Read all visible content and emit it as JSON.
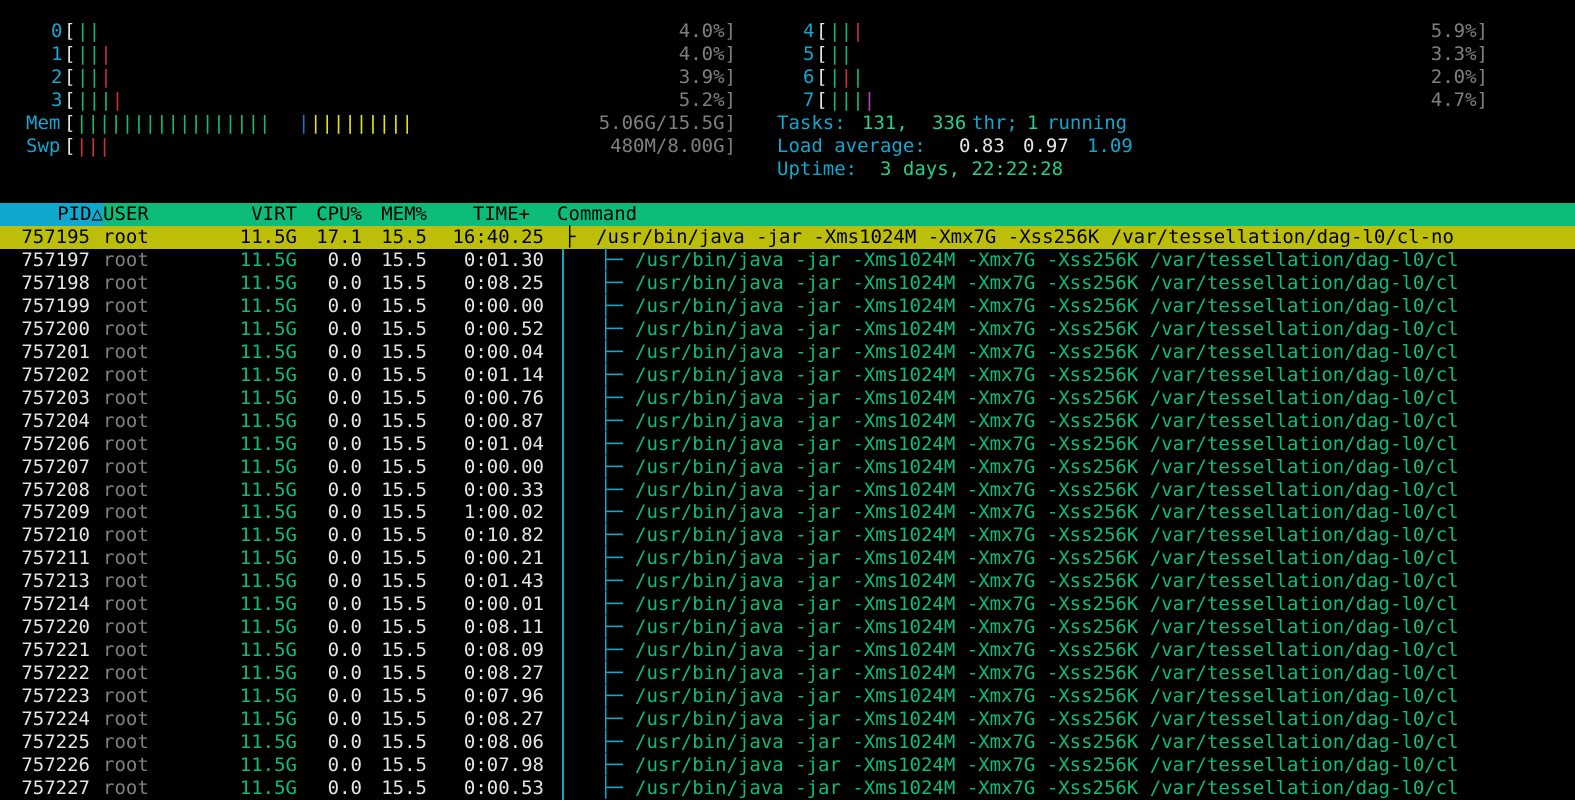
{
  "cpu_meters": [
    {
      "id": "0",
      "bars": "||",
      "colors": [
        "#0dbc79",
        "#0dbc79"
      ],
      "value": "4.0%]"
    },
    {
      "id": "1",
      "bars": "|||",
      "colors": [
        "#0dbc79",
        "#0dbc79",
        "#cd3131"
      ],
      "value": "4.0%]"
    },
    {
      "id": "2",
      "bars": "|||",
      "colors": [
        "#0dbc79",
        "#0dbc79",
        "#cd3131"
      ],
      "value": "3.9%]"
    },
    {
      "id": "3",
      "bars": "||||",
      "colors": [
        "#0dbc79",
        "#0dbc79",
        "#0dbc79",
        "#cd3131"
      ],
      "value": "5.2%]"
    },
    {
      "id": "4",
      "bars": "|||",
      "colors": [
        "#0dbc79",
        "#0dbc79",
        "#cd3131"
      ],
      "value": "5.9%]"
    },
    {
      "id": "5",
      "bars": "||",
      "colors": [
        "#0dbc79",
        "#0dbc79"
      ],
      "value": "3.3%]"
    },
    {
      "id": "6",
      "bars": "|||",
      "colors": [
        "#0dbc79",
        "#cd3131",
        "#0dbc79"
      ],
      "value": "2.0%]"
    },
    {
      "id": "7",
      "bars": "||||",
      "colors": [
        "#0dbc79",
        "#0dbc79",
        "#0dbc79",
        "#bc3fbc"
      ],
      "value": "4.7%]"
    }
  ],
  "mem": {
    "label": "Mem",
    "value": "5.06G/15.5G]",
    "green_bars": "|||||||||||||||||",
    "blue_bars": "|",
    "yellow_bars": "|||||||||"
  },
  "swp": {
    "label": "Swp",
    "value": "480M/8.00G]",
    "red_bars": "|||"
  },
  "tasks": {
    "label": "Tasks:",
    "count": "131,",
    "thr": "336",
    "thr_label": "thr;",
    "running": "1",
    "running_label": "running"
  },
  "load": {
    "label": "Load average:",
    "one": "0.83",
    "five": "0.97",
    "fifteen": "1.09"
  },
  "uptime": {
    "label": "Uptime:",
    "value": "3 days, 22:22:28"
  },
  "columns": {
    "pid": "PID△",
    "user": "USER",
    "virt": "VIRT",
    "cpu": "CPU%",
    "mem": "MEM%",
    "time": "TIME+",
    "command": "Command"
  },
  "selected_process": {
    "pid": "757195",
    "user": "root",
    "virt": "11.5G",
    "cpu": "17.1",
    "mem": "15.5",
    "time": "16:40.25",
    "tree": "├",
    "command": "/usr/bin/java -jar -Xms1024M -Xmx7G -Xss256K /var/tessellation/dag-l0/cl-no"
  },
  "threads": [
    {
      "pid": "757197",
      "user": "root",
      "virt": "11.5G",
      "cpu": "0.0",
      "mem": "15.5",
      "time": "0:01.30",
      "tree": "├─",
      "command": "/usr/bin/java -jar -Xms1024M -Xmx7G -Xss256K /var/tessellation/dag-l0/cl"
    },
    {
      "pid": "757198",
      "user": "root",
      "virt": "11.5G",
      "cpu": "0.0",
      "mem": "15.5",
      "time": "0:08.25",
      "tree": "├─",
      "command": "/usr/bin/java -jar -Xms1024M -Xmx7G -Xss256K /var/tessellation/dag-l0/cl"
    },
    {
      "pid": "757199",
      "user": "root",
      "virt": "11.5G",
      "cpu": "0.0",
      "mem": "15.5",
      "time": "0:00.00",
      "tree": "├─",
      "command": "/usr/bin/java -jar -Xms1024M -Xmx7G -Xss256K /var/tessellation/dag-l0/cl"
    },
    {
      "pid": "757200",
      "user": "root",
      "virt": "11.5G",
      "cpu": "0.0",
      "mem": "15.5",
      "time": "0:00.52",
      "tree": "├─",
      "command": "/usr/bin/java -jar -Xms1024M -Xmx7G -Xss256K /var/tessellation/dag-l0/cl"
    },
    {
      "pid": "757201",
      "user": "root",
      "virt": "11.5G",
      "cpu": "0.0",
      "mem": "15.5",
      "time": "0:00.04",
      "tree": "├─",
      "command": "/usr/bin/java -jar -Xms1024M -Xmx7G -Xss256K /var/tessellation/dag-l0/cl"
    },
    {
      "pid": "757202",
      "user": "root",
      "virt": "11.5G",
      "cpu": "0.0",
      "mem": "15.5",
      "time": "0:01.14",
      "tree": "├─",
      "command": "/usr/bin/java -jar -Xms1024M -Xmx7G -Xss256K /var/tessellation/dag-l0/cl"
    },
    {
      "pid": "757203",
      "user": "root",
      "virt": "11.5G",
      "cpu": "0.0",
      "mem": "15.5",
      "time": "0:00.76",
      "tree": "├─",
      "command": "/usr/bin/java -jar -Xms1024M -Xmx7G -Xss256K /var/tessellation/dag-l0/cl"
    },
    {
      "pid": "757204",
      "user": "root",
      "virt": "11.5G",
      "cpu": "0.0",
      "mem": "15.5",
      "time": "0:00.87",
      "tree": "├─",
      "command": "/usr/bin/java -jar -Xms1024M -Xmx7G -Xss256K /var/tessellation/dag-l0/cl"
    },
    {
      "pid": "757206",
      "user": "root",
      "virt": "11.5G",
      "cpu": "0.0",
      "mem": "15.5",
      "time": "0:01.04",
      "tree": "├─",
      "command": "/usr/bin/java -jar -Xms1024M -Xmx7G -Xss256K /var/tessellation/dag-l0/cl"
    },
    {
      "pid": "757207",
      "user": "root",
      "virt": "11.5G",
      "cpu": "0.0",
      "mem": "15.5",
      "time": "0:00.00",
      "tree": "├─",
      "command": "/usr/bin/java -jar -Xms1024M -Xmx7G -Xss256K /var/tessellation/dag-l0/cl"
    },
    {
      "pid": "757208",
      "user": "root",
      "virt": "11.5G",
      "cpu": "0.0",
      "mem": "15.5",
      "time": "0:00.33",
      "tree": "├─",
      "command": "/usr/bin/java -jar -Xms1024M -Xmx7G -Xss256K /var/tessellation/dag-l0/cl"
    },
    {
      "pid": "757209",
      "user": "root",
      "virt": "11.5G",
      "cpu": "0.0",
      "mem": "15.5",
      "time": "1:00.02",
      "tree": "├─",
      "command": "/usr/bin/java -jar -Xms1024M -Xmx7G -Xss256K /var/tessellation/dag-l0/cl"
    },
    {
      "pid": "757210",
      "user": "root",
      "virt": "11.5G",
      "cpu": "0.0",
      "mem": "15.5",
      "time": "0:10.82",
      "tree": "├─",
      "command": "/usr/bin/java -jar -Xms1024M -Xmx7G -Xss256K /var/tessellation/dag-l0/cl"
    },
    {
      "pid": "757211",
      "user": "root",
      "virt": "11.5G",
      "cpu": "0.0",
      "mem": "15.5",
      "time": "0:00.21",
      "tree": "├─",
      "command": "/usr/bin/java -jar -Xms1024M -Xmx7G -Xss256K /var/tessellation/dag-l0/cl"
    },
    {
      "pid": "757213",
      "user": "root",
      "virt": "11.5G",
      "cpu": "0.0",
      "mem": "15.5",
      "time": "0:01.43",
      "tree": "├─",
      "command": "/usr/bin/java -jar -Xms1024M -Xmx7G -Xss256K /var/tessellation/dag-l0/cl"
    },
    {
      "pid": "757214",
      "user": "root",
      "virt": "11.5G",
      "cpu": "0.0",
      "mem": "15.5",
      "time": "0:00.01",
      "tree": "├─",
      "command": "/usr/bin/java -jar -Xms1024M -Xmx7G -Xss256K /var/tessellation/dag-l0/cl"
    },
    {
      "pid": "757220",
      "user": "root",
      "virt": "11.5G",
      "cpu": "0.0",
      "mem": "15.5",
      "time": "0:08.11",
      "tree": "├─",
      "command": "/usr/bin/java -jar -Xms1024M -Xmx7G -Xss256K /var/tessellation/dag-l0/cl"
    },
    {
      "pid": "757221",
      "user": "root",
      "virt": "11.5G",
      "cpu": "0.0",
      "mem": "15.5",
      "time": "0:08.09",
      "tree": "├─",
      "command": "/usr/bin/java -jar -Xms1024M -Xmx7G -Xss256K /var/tessellation/dag-l0/cl"
    },
    {
      "pid": "757222",
      "user": "root",
      "virt": "11.5G",
      "cpu": "0.0",
      "mem": "15.5",
      "time": "0:08.27",
      "tree": "├─",
      "command": "/usr/bin/java -jar -Xms1024M -Xmx7G -Xss256K /var/tessellation/dag-l0/cl"
    },
    {
      "pid": "757223",
      "user": "root",
      "virt": "11.5G",
      "cpu": "0.0",
      "mem": "15.5",
      "time": "0:07.96",
      "tree": "├─",
      "command": "/usr/bin/java -jar -Xms1024M -Xmx7G -Xss256K /var/tessellation/dag-l0/cl"
    },
    {
      "pid": "757224",
      "user": "root",
      "virt": "11.5G",
      "cpu": "0.0",
      "mem": "15.5",
      "time": "0:08.27",
      "tree": "├─",
      "command": "/usr/bin/java -jar -Xms1024M -Xmx7G -Xss256K /var/tessellation/dag-l0/cl"
    },
    {
      "pid": "757225",
      "user": "root",
      "virt": "11.5G",
      "cpu": "0.0",
      "mem": "15.5",
      "time": "0:08.06",
      "tree": "├─",
      "command": "/usr/bin/java -jar -Xms1024M -Xmx7G -Xss256K /var/tessellation/dag-l0/cl"
    },
    {
      "pid": "757226",
      "user": "root",
      "virt": "11.5G",
      "cpu": "0.0",
      "mem": "15.5",
      "time": "0:07.98",
      "tree": "├─",
      "command": "/usr/bin/java -jar -Xms1024M -Xmx7G -Xss256K /var/tessellation/dag-l0/cl"
    },
    {
      "pid": "757227",
      "user": "root",
      "virt": "11.5G",
      "cpu": "0.0",
      "mem": "15.5",
      "time": "0:00.53",
      "tree": "├─",
      "command": "/usr/bin/java -jar -Xms1024M -Xmx7G -Xss256K /var/tessellation/dag-l0/cl"
    }
  ]
}
